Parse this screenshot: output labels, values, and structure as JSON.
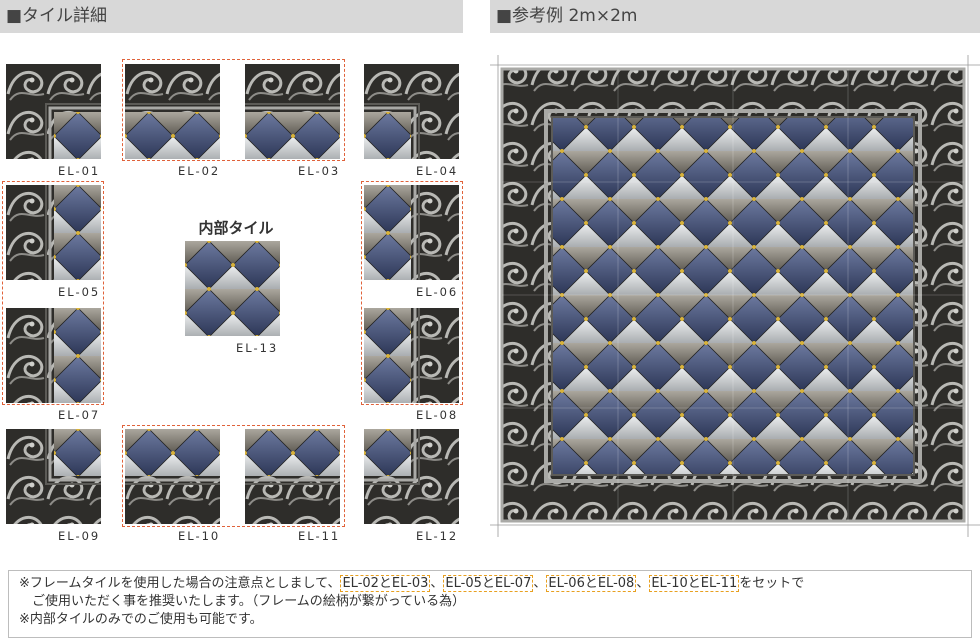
{
  "header_left": "■タイル詳細",
  "header_right": "■参考例 2m×2m",
  "interior_title": "内部タイル",
  "tiles": {
    "el01": "EL-01",
    "el02": "EL-02",
    "el03": "EL-03",
    "el04": "EL-04",
    "el05": "EL-05",
    "el06": "EL-06",
    "el07": "EL-07",
    "el08": "EL-08",
    "el09": "EL-09",
    "el10": "EL-10",
    "el11": "EL-11",
    "el12": "EL-12",
    "el13": "EL-13"
  },
  "note": {
    "line1_prefix": "※フレームタイルを使用した場合の注意点としまして、",
    "pair1": "EL-02とEL-03",
    "sep": "、",
    "pair2": "EL-05とEL-07",
    "pair3": "EL-06とEL-08",
    "pair4": "EL-10とEL-11",
    "line1_suffix": "をセットで",
    "line2": "ご使用いただく事を推奨いたします。（フレームの絵柄が繋がっている為）",
    "line3": "※内部タイルのみでのご使用も可能です。"
  },
  "colors": {
    "header_bg": "#d8d8d8",
    "pair_border": "#e0623a",
    "note_highlight": "#e8a020",
    "diamond_blue": "#3d4a6e",
    "diamond_gray": "#8a8780",
    "diamond_light": "#c9cdd0",
    "frame_dark": "#2e2d2a",
    "frame_silver": "#a9a9a6"
  }
}
